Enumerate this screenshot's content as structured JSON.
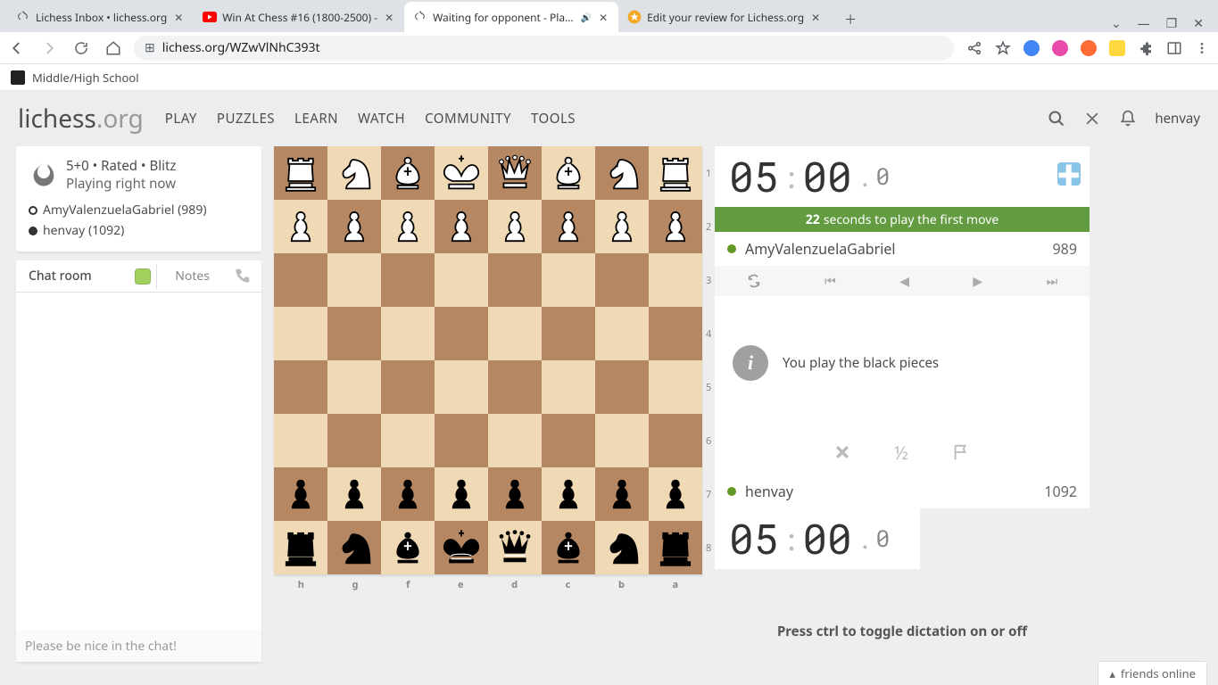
{
  "browser": {
    "tabs": [
      {
        "label": "Lichess Inbox • lichess.org"
      },
      {
        "label": "Win At Chess #16 (1800-2500) -"
      },
      {
        "label": "Waiting for opponent - Play A"
      },
      {
        "label": "Edit your review for Lichess.org"
      }
    ],
    "url": "lichess.org/WZwVlNhC393t"
  },
  "bookmark": "Middle/High School",
  "logo_main": "lichess",
  "logo_suffix": ".org",
  "menu": [
    "PLAY",
    "PUZZLES",
    "LEARN",
    "WATCH",
    "COMMUNITY",
    "TOOLS"
  ],
  "username": "henvay",
  "game": {
    "clock_desc": "5+0 • Rated • Blitz",
    "status": "Playing right now",
    "opponent": "AmyValenzuelaGabriel (989)",
    "me": "henvay (1092)"
  },
  "chat": {
    "tab1": "Chat room",
    "tab2": "Notes",
    "placeholder": "Please be nice in the chat!"
  },
  "board": {
    "ranks": [
      "1",
      "2",
      "3",
      "4",
      "5",
      "6",
      "7",
      "8"
    ],
    "files": [
      "h",
      "g",
      "f",
      "e",
      "d",
      "c",
      "b",
      "a"
    ]
  },
  "clock_top": {
    "m": "05",
    "s": "00",
    "t": "0"
  },
  "clock_bot": {
    "m": "05",
    "s": "00",
    "t": "0"
  },
  "firstmove_n": "22",
  "firstmove_text": "seconds to play the first move",
  "opp": {
    "name": "AmyValenzuelaGabriel",
    "rating": "989"
  },
  "me": {
    "name": "henvay",
    "rating": "1092"
  },
  "info_msg": "You play the black pieces",
  "half": "½",
  "dictation": "Press ctrl to toggle dictation on or off",
  "friends": "friends online"
}
